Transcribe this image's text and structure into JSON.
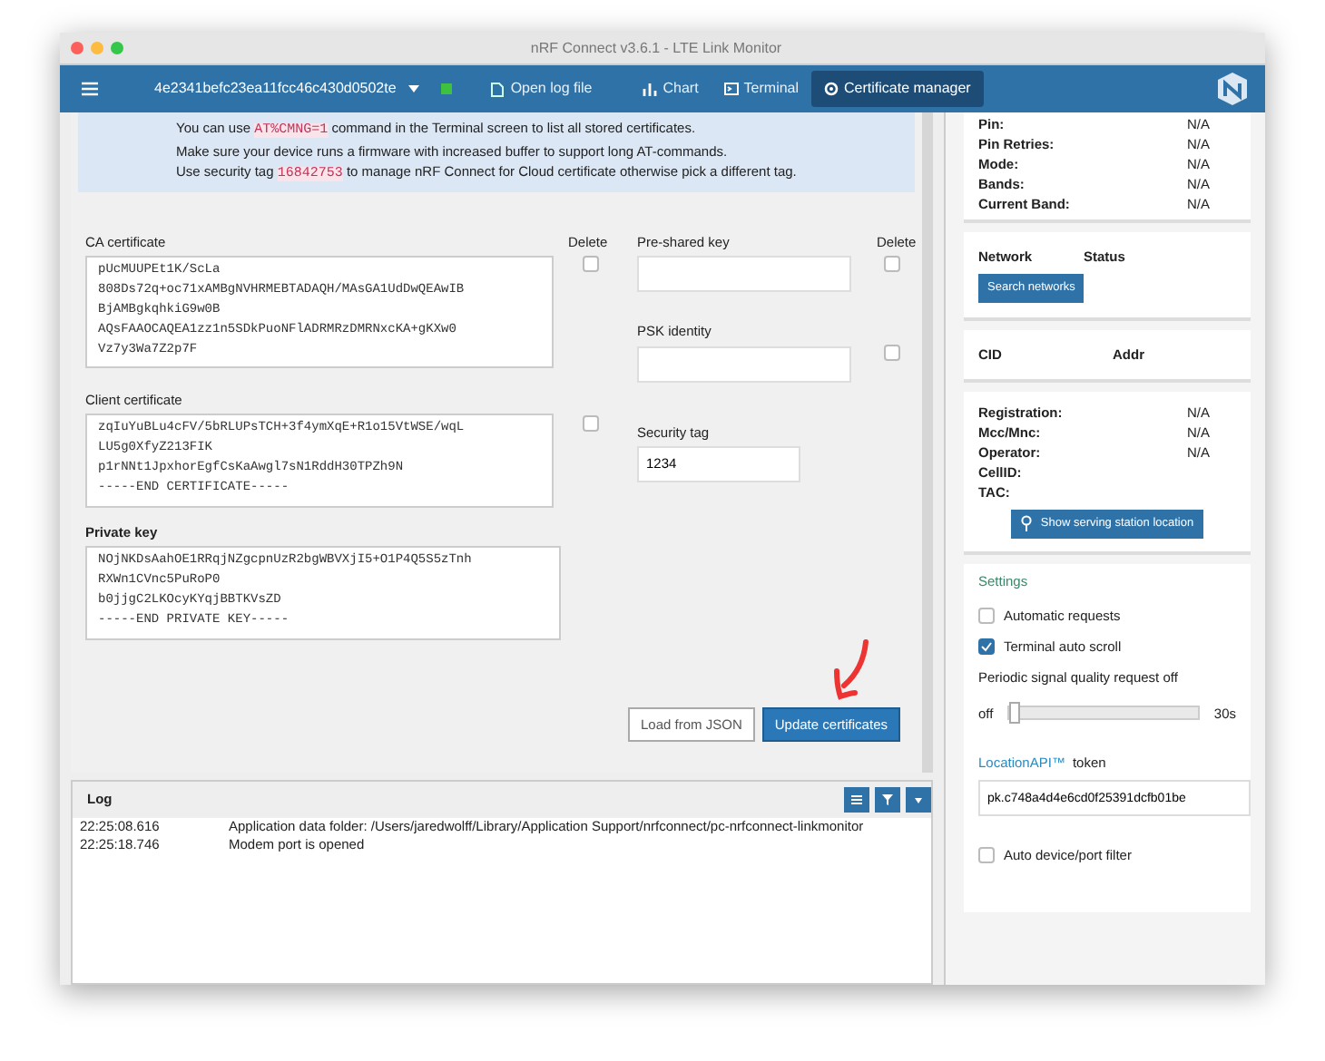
{
  "window": {
    "title": "nRF Connect v3.6.1 - LTE Link Monitor"
  },
  "navbar": {
    "device": "4e2341befc23ea11fcc46c430d0502te",
    "connected": true,
    "items": [
      {
        "kind": "file",
        "label": "Open log file",
        "selected": false
      },
      {
        "kind": "chart",
        "label": "Chart",
        "selected": false
      },
      {
        "kind": "terminal",
        "label": "Terminal",
        "selected": false
      },
      {
        "kind": "certificate",
        "label": "Certificate manager",
        "selected": true
      }
    ]
  },
  "notice": [
    {
      "before": "You can use ",
      "code": "AT%CMNG=1",
      "after": " command in the Terminal screen to list all stored certificates."
    },
    {
      "before": "Make sure your device runs a firmware with increased buffer to support long AT-commands."
    },
    {
      "before": "Use security tag ",
      "code": "16842753",
      "after": " to manage nRF Connect for Cloud certificate otherwise pick a different tag."
    }
  ],
  "delete_headers": [
    "Delete",
    "Delete"
  ],
  "certificates": [
    {
      "label": "CA certificate",
      "delete": false,
      "lines": [
        "pUcMUUPEt1K/ScLa",
        "808Ds72q+oc71xAMBgNVHRMEBTADAQH/MAsGA1UdDwQEAwIB",
        "BjAMBgkqhkiG9w0B",
        "AQsFAAOCAQEA1zz1n5SDkPuoNFlADRMRzDMRNxcKA+gKXw0",
        "Vz7y3Wa7Z2p7F"
      ]
    },
    {
      "label": "Client certificate",
      "delete": false,
      "lines": [
        "zqIuYuBLu4cFV/5bRLUPsTCH+3f4ymXqE+R1o15VtWSE/wqL",
        "LU5g0XfyZ213FIK",
        "p1rNNt1JpxhorEgfCsKaAwgl7sN1RddH30TPZh9N",
        "-----END CERTIFICATE-----"
      ]
    },
    {
      "label": "Private key",
      "lines": [
        "NOjNKDsAahOE1RRqjNZgcpnUzR2bgWBVXjI5+O1P4Q5S5zTnh",
        "RXWn1CVnc5PuRoP0",
        "b0jjgC2LKOcyKYqjBBTKVsZD",
        "-----END PRIVATE KEY-----"
      ]
    }
  ],
  "keys": [
    {
      "label": "Pre-shared key",
      "delete": false
    },
    {
      "label": "PSK identity",
      "delete": false
    },
    {
      "label": "Security tag",
      "value": "1234"
    }
  ],
  "buttons": [
    {
      "label": "Load from JSON",
      "kind": "secondary"
    },
    {
      "label": "Update certificates",
      "kind": "primary"
    }
  ],
  "log": {
    "title": "Log",
    "entries": [
      {
        "time": "22:25:08.616",
        "message": "Application data folder: /Users/jaredwolff/Library/Application Support/nrfconnect/pc-nrfconnect-linkmonitor"
      },
      {
        "time": "22:25:18.746",
        "message": "Modem port is opened"
      }
    ]
  },
  "sidebar": {
    "status": [
      {
        "label": "Pin:",
        "value": "N/A"
      },
      {
        "label": "Pin Retries:",
        "value": "N/A"
      },
      {
        "label": "Mode:",
        "value": "N/A"
      },
      {
        "label": "Bands:",
        "value": "N/A"
      },
      {
        "label": "Current Band:",
        "value": "N/A"
      }
    ],
    "network_columns": [
      "Network",
      "Status"
    ],
    "search_button": "Search networks",
    "cell_columns": [
      "CID",
      "Addr"
    ],
    "registration": [
      {
        "label": "Registration:",
        "value": "N/A"
      },
      {
        "label": "Mcc/Mnc:",
        "value": "N/A"
      },
      {
        "label": "Operator:",
        "value": "N/A"
      },
      {
        "label": "CellID:"
      },
      {
        "label": "TAC:"
      }
    ],
    "location_button": "Show serving station location",
    "settings_title": "Settings",
    "checks": [
      {
        "label": "Automatic requests",
        "checked": false
      },
      {
        "label": "Terminal auto scroll",
        "checked": true
      }
    ],
    "signal_label": "Periodic signal quality request off",
    "slider": {
      "min_label": "off",
      "max_label": "30s",
      "level": 0
    },
    "token_link": "LocationAPI™",
    "token_label": "token",
    "token_value": "pk.c748a4d4e6cd0f25391dcfb01be",
    "filter": {
      "label": "Auto device/port filter",
      "checked": false
    }
  }
}
